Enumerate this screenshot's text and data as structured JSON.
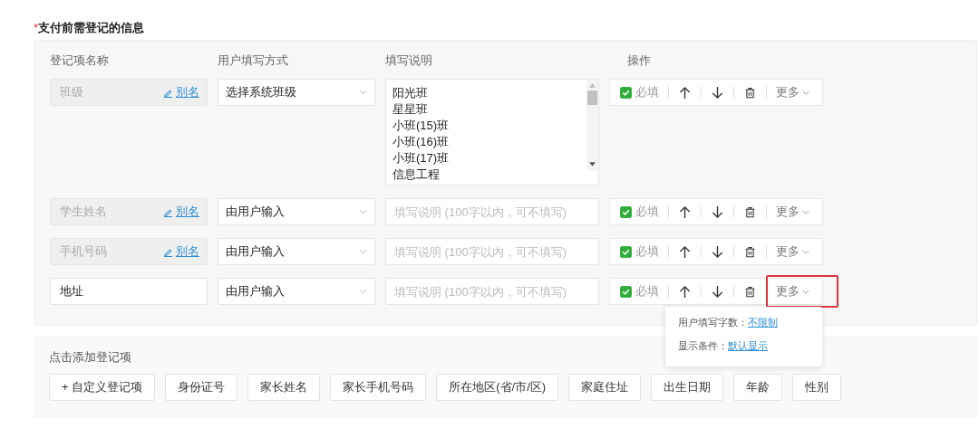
{
  "section": {
    "required_mark": "*",
    "title": "支付前需登记的信息"
  },
  "columns": [
    "登记项名称",
    "用户填写方式",
    "填写说明",
    "操作"
  ],
  "rows": [
    {
      "name": "班级",
      "locked": true,
      "alias": "别名",
      "mode": "选择系统班级",
      "description": {
        "kind": "options",
        "options": [
          "阳光班",
          "星星班",
          "小班(15)班",
          "小班(16)班",
          "小班(17)班",
          "信息工程"
        ]
      },
      "required": true,
      "required_label": "必填",
      "more": "更多",
      "highlighted": false
    },
    {
      "name": "学生姓名",
      "locked": true,
      "alias": "别名",
      "mode": "由用户输入",
      "description": {
        "kind": "text",
        "placeholder": "填写说明 (100字以内，可不填写)"
      },
      "required": true,
      "required_label": "必填",
      "more": "更多",
      "highlighted": false
    },
    {
      "name": "手机号码",
      "locked": true,
      "alias": "别名",
      "mode": "由用户输入",
      "description": {
        "kind": "text",
        "placeholder": "填写说明 (100字以内，可不填写)"
      },
      "required": true,
      "required_label": "必填",
      "more": "更多",
      "highlighted": false
    },
    {
      "name": "地址",
      "locked": false,
      "mode": "由用户输入",
      "description": {
        "kind": "text",
        "placeholder": "填写说明 (100字以内，可不填写)"
      },
      "required": true,
      "required_label": "必填",
      "more": "更多",
      "highlighted": true,
      "menu": [
        {
          "label": "用户填写字数：",
          "value": "不限制"
        },
        {
          "label": "显示条件：",
          "value": "默认显示"
        }
      ]
    }
  ],
  "add_section": {
    "title": "点击添加登记项",
    "buttons": [
      "+ 自定义登记项",
      "身份证号",
      "家长姓名",
      "家长手机号码",
      "所在地区(省/市/区)",
      "家庭住址",
      "出生日期",
      "年龄",
      "性别"
    ]
  }
}
